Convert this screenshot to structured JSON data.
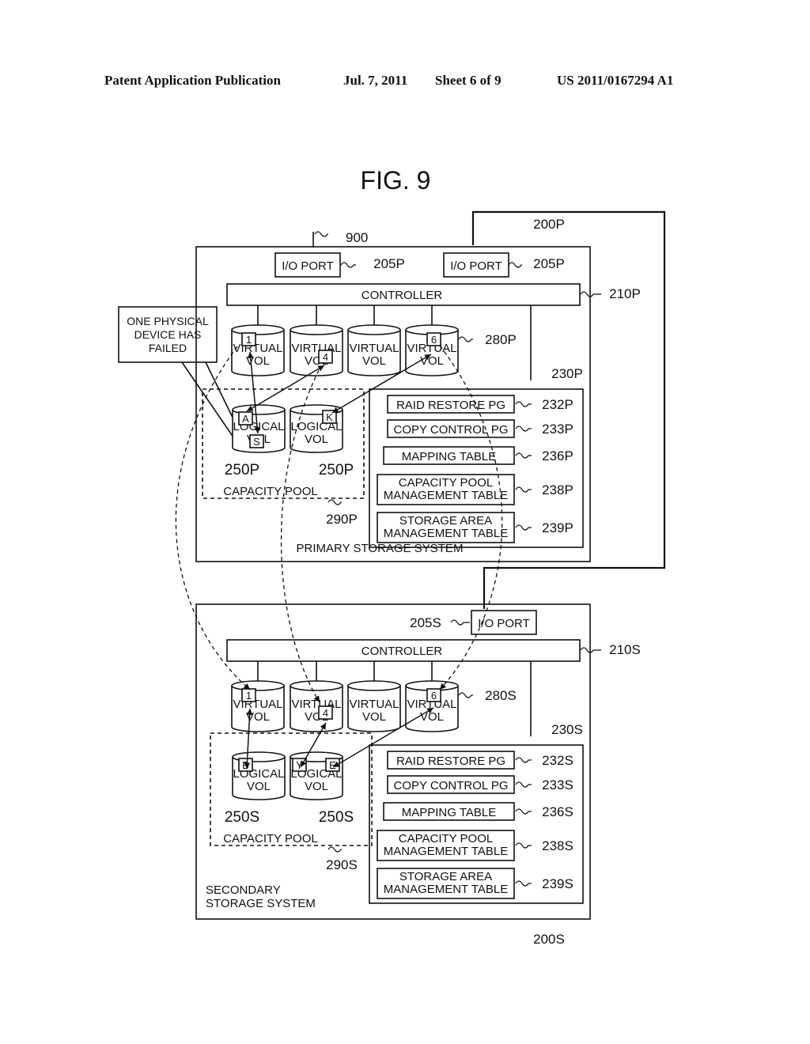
{
  "header": {
    "left": "Patent Application Publication",
    "date": "Jul. 7, 2011",
    "sheet": "Sheet 6 of 9",
    "number": "US 2011/0167294 A1"
  },
  "figure_title": "FIG. 9",
  "callout": [
    "ONE PHYSICAL",
    "DEVICE HAS",
    "FAILED"
  ],
  "network_ref": "900",
  "primary": {
    "ref": "200P",
    "name": "PRIMARY STORAGE SYSTEM",
    "io_port_label": "I/O PORT",
    "io_port_ref": "205P",
    "controller_label": "CONTROLLER",
    "controller_ref": "210P",
    "virtual_vol_ref": "280P",
    "memory_ref": "230P",
    "pool_label": "CAPACITY POOL",
    "pool_ref": "290P",
    "logical_vol_ref": "250P",
    "virtual_vols": [
      {
        "l1": "VIRTUAL",
        "l2": "VOL",
        "tag": "1"
      },
      {
        "l1": "VIRTUAL",
        "l2": "VOL",
        "tag": "4"
      },
      {
        "l1": "VIRTUAL",
        "l2": "VOL",
        "tag": ""
      },
      {
        "l1": "VIRTUAL",
        "l2": "VOL",
        "tag": "6"
      }
    ],
    "logical_vols": [
      {
        "l1": "LOGICAL",
        "l2": "VOL",
        "tags": [
          "A",
          "S"
        ]
      },
      {
        "l1": "LOGICAL",
        "l2": "VOL",
        "tags": [
          "K"
        ]
      }
    ],
    "programs": [
      {
        "label": "RAID RESTORE PG",
        "ref": "232P"
      },
      {
        "label": "COPY CONTROL PG",
        "ref": "233P"
      },
      {
        "label": "MAPPING TABLE",
        "ref": "236P"
      },
      {
        "label": "CAPACITY POOL|MANAGEMENT TABLE",
        "ref": "238P"
      },
      {
        "label": "STORAGE AREA|MANAGEMENT TABLE",
        "ref": "239P"
      }
    ]
  },
  "secondary": {
    "ref": "200S",
    "name": "SECONDARY|STORAGE SYSTEM",
    "io_port_label": "I/O PORT",
    "io_port_ref": "205S",
    "controller_label": "CONTROLLER",
    "controller_ref": "210S",
    "virtual_vol_ref": "280S",
    "memory_ref": "230S",
    "pool_label": "CAPACITY POOL",
    "pool_ref": "290S",
    "logical_vol_ref": "250S",
    "virtual_vols": [
      {
        "l1": "VIRTUAL",
        "l2": "VOL",
        "tag": "1"
      },
      {
        "l1": "VIRTUAL",
        "l2": "VOL",
        "tag": "4"
      },
      {
        "l1": "VIRTUAL",
        "l2": "VOL",
        "tag": ""
      },
      {
        "l1": "VIRTUAL",
        "l2": "VOL",
        "tag": "6"
      }
    ],
    "logical_vols": [
      {
        "l1": "LOGICAL",
        "l2": "VOL",
        "tags": [
          "B"
        ]
      },
      {
        "l1": "LOGICAL",
        "l2": "VOL",
        "tags": [
          "Y",
          "E"
        ]
      }
    ],
    "programs": [
      {
        "label": "RAID RESTORE PG",
        "ref": "232S"
      },
      {
        "label": "COPY CONTROL PG",
        "ref": "233S"
      },
      {
        "label": "MAPPING TABLE",
        "ref": "236S"
      },
      {
        "label": "CAPACITY POOL|MANAGEMENT TABLE",
        "ref": "238S"
      },
      {
        "label": "STORAGE AREA|MANAGEMENT TABLE",
        "ref": "239S"
      }
    ]
  }
}
